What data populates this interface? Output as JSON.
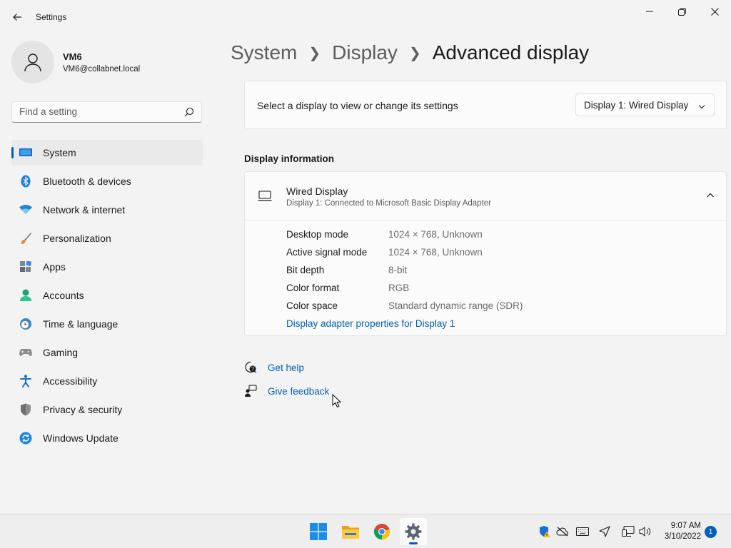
{
  "window": {
    "app_title": "Settings",
    "back_icon": "arrow-left-icon",
    "controls": [
      "minimize-icon",
      "maximize-icon",
      "close-icon"
    ]
  },
  "profile": {
    "name": "VM6",
    "email": "VM6@collabnet.local",
    "avatar_icon": "person-icon"
  },
  "search": {
    "placeholder": "Find a setting",
    "icon": "search-icon"
  },
  "sidebar": {
    "items": [
      {
        "label": "System",
        "icon": "system-icon",
        "active": true
      },
      {
        "label": "Bluetooth & devices",
        "icon": "bluetooth-icon"
      },
      {
        "label": "Network & internet",
        "icon": "wifi-icon"
      },
      {
        "label": "Personalization",
        "icon": "brush-icon"
      },
      {
        "label": "Apps",
        "icon": "apps-icon"
      },
      {
        "label": "Accounts",
        "icon": "accounts-icon"
      },
      {
        "label": "Time & language",
        "icon": "clock-globe-icon"
      },
      {
        "label": "Gaming",
        "icon": "gamepad-icon"
      },
      {
        "label": "Accessibility",
        "icon": "accessibility-icon"
      },
      {
        "label": "Privacy & security",
        "icon": "shield-icon"
      },
      {
        "label": "Windows Update",
        "icon": "update-icon"
      }
    ]
  },
  "breadcrumb": {
    "items": [
      "System",
      "Display"
    ],
    "current": "Advanced display"
  },
  "select_display": {
    "label": "Select a display to view or change its settings",
    "value": "Display 1: Wired Display"
  },
  "display_info": {
    "section_title": "Display information",
    "name": "Wired Display",
    "subtitle": "Display 1: Connected to Microsoft Basic Display Adapter",
    "rows": [
      {
        "key": "Desktop mode",
        "value": "1024 × 768, Unknown"
      },
      {
        "key": "Active signal mode",
        "value": "1024 × 768, Unknown"
      },
      {
        "key": "Bit depth",
        "value": "8-bit"
      },
      {
        "key": "Color format",
        "value": "RGB"
      },
      {
        "key": "Color space",
        "value": "Standard dynamic range (SDR)"
      }
    ],
    "adapter_link": "Display adapter properties for Display 1"
  },
  "help": {
    "get_help": "Get help",
    "give_feedback": "Give feedback"
  },
  "taskbar": {
    "apps": [
      "windows-start-icon",
      "file-explorer-icon",
      "chrome-icon",
      "settings-gear-icon"
    ],
    "tray": [
      "security-shield-icon",
      "cloud-offline-icon",
      "keyboard-icon",
      "location-icon",
      "network-icon",
      "volume-icon"
    ],
    "time": "9:07 AM",
    "date": "3/10/2022",
    "notification_count": "1"
  },
  "colors": {
    "accent": "#005fb8",
    "background": "#f3f3f3",
    "card": "#fbfbfb"
  }
}
